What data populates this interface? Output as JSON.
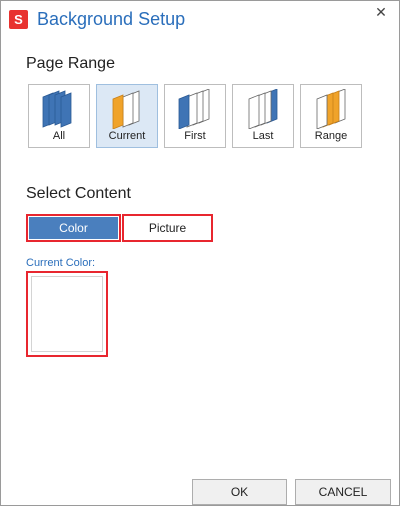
{
  "window": {
    "app_icon_letter": "S",
    "title": "Background Setup",
    "close_glyph": "✕"
  },
  "page_range": {
    "heading": "Page Range",
    "selected": "Current",
    "options": [
      {
        "label": "All",
        "icon": "all-pages-icon"
      },
      {
        "label": "Current",
        "icon": "current-page-icon"
      },
      {
        "label": "First",
        "icon": "first-page-icon"
      },
      {
        "label": "Last",
        "icon": "last-page-icon"
      },
      {
        "label": "Range",
        "icon": "range-pages-icon"
      }
    ]
  },
  "select_content": {
    "heading": "Select Content",
    "color_button": "Color",
    "picture_button": "Picture",
    "active": "Color"
  },
  "current_color": {
    "label": "Current Color:",
    "value": "#ffffff"
  },
  "footer": {
    "ok": "OK",
    "cancel": "CANCEL"
  },
  "colors": {
    "accent_blue": "#2a6ebb",
    "page_blue": "#3f74b5",
    "page_orange": "#f0a32a",
    "highlight_red": "#e8262f"
  }
}
